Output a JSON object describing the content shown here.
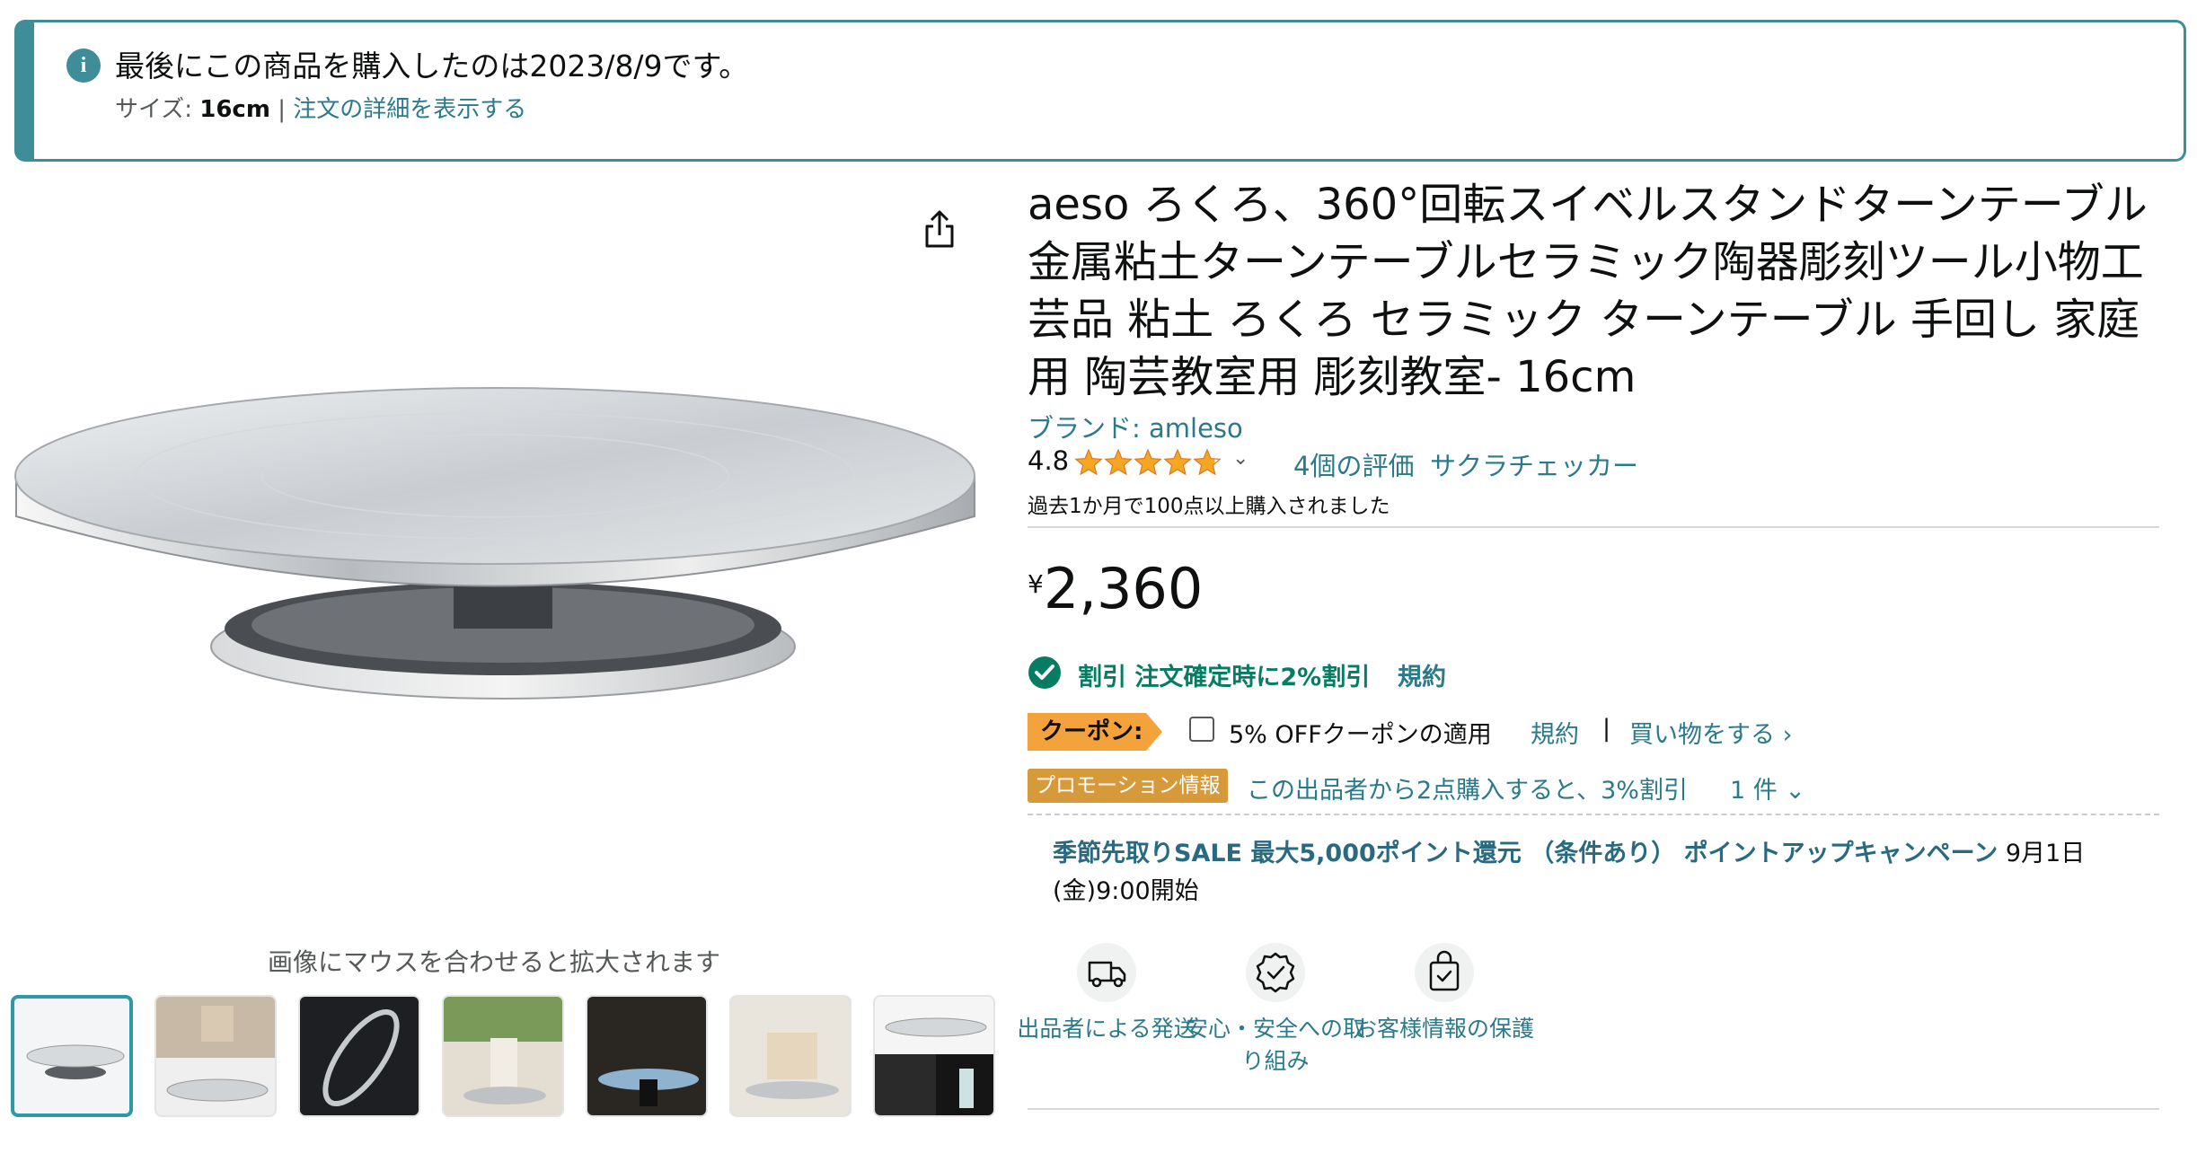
{
  "banner": {
    "title": "最後にこの商品を購入したのは2023/8/9です。",
    "size_label": "サイズ: ",
    "size_value": "16cm",
    "separator": " | ",
    "details_link": "注文の詳細を表示する"
  },
  "gallery": {
    "zoom_hint": "画像にマウスを合わせると拡大されます",
    "thumbnail_count": 7,
    "selected_index": 0
  },
  "product": {
    "title": "aeso ろくろ、360°回転スイベルスタンドターンテーブル 金属粘土ターンテーブルセラミック陶器彫刻ツール小物工芸品 粘土 ろくろ セラミック ターンテーブル 手回し 家庭用 陶芸教室用 彫刻教室- 16cm",
    "brand": "ブランド: amleso",
    "rating": "4.8",
    "rating_value": 4.8,
    "rating_max": 5,
    "review_count": "4個の評価",
    "sakura_checker": "サクラチェッカー",
    "bought_recently": "過去1か月で100点以上購入されました"
  },
  "price": {
    "currency": "¥",
    "amount": "2,360"
  },
  "discount": {
    "text": "割引 注文確定時に2%割引",
    "terms": "規約"
  },
  "coupon": {
    "badge": "クーポン:",
    "apply_text": "5% OFFクーポンの適用",
    "terms": "規約",
    "separator": "|",
    "shop_link": "買い物をする ›"
  },
  "promotion": {
    "badge": "プロモーション情報",
    "text": "この出品者から2点購入すると、3%割引",
    "count": "1 件 ⌄"
  },
  "sale": {
    "highlight": "季節先取りSALE 最大5,000ポイント還元 （条件あり） ポイントアップキャンペーン",
    "date": " 9月1日(金)9:00開始"
  },
  "features": [
    {
      "icon": "delivery-truck-icon",
      "label": "出品者による発送"
    },
    {
      "icon": "safety-badge-icon",
      "label": "安心・安全への取り組み"
    },
    {
      "icon": "secure-bag-icon",
      "label": "お客様情報の保護"
    }
  ],
  "colors": {
    "accent_teal": "#3f8d99",
    "link": "#2a7a8c",
    "discount_green": "#067d62",
    "coupon_orange": "#f4a23c",
    "star": "#f5a623"
  }
}
